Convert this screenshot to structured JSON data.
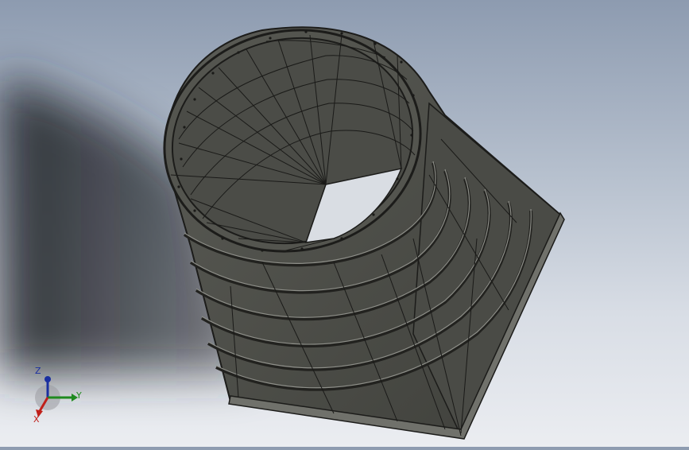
{
  "viewport": {
    "model_name": "duct-transition-round-to-square"
  },
  "triad": {
    "x_label": "X",
    "y_label": "Y",
    "z_label": "Z",
    "colors": {
      "x": "#c0201a",
      "y": "#1f8a1f",
      "z": "#1a2fa0"
    }
  }
}
